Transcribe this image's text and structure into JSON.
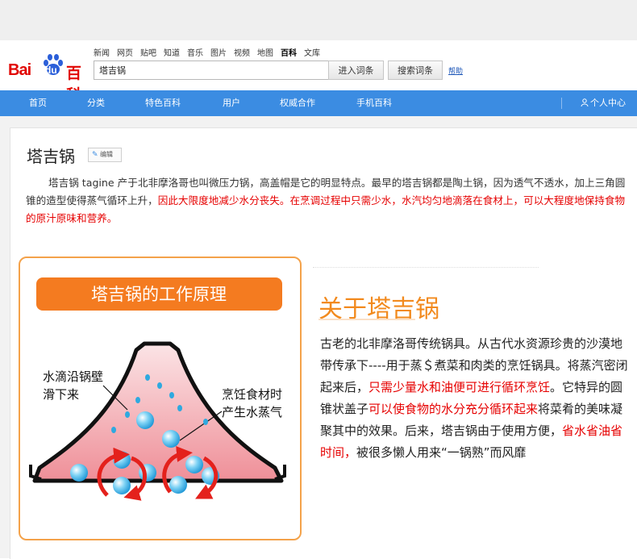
{
  "header": {
    "logo_text_bai": "Bai",
    "logo_text_du": "du",
    "logo_text_baike": "百科",
    "top_links": [
      "新闻",
      "网页",
      "贴吧",
      "知道",
      "音乐",
      "图片",
      "视频",
      "地图",
      "百科",
      "文库"
    ],
    "active_link": "百科",
    "search_value": "塔吉锅",
    "enter_button": "进入词条",
    "search_button": "搜索词条",
    "help_link": "帮助"
  },
  "navbar": {
    "items": [
      "首页",
      "分类",
      "特色百科",
      "用户",
      "权威合作",
      "手机百科"
    ],
    "user_center": "个人中心"
  },
  "entry": {
    "title": "塔吉锅",
    "edit_label": "编辑",
    "intro_plain": "塔吉锅 tagine 产于北非摩洛哥也叫微压力锅，高盖帽是它的明显特点。最早的塔吉锅都是陶土锅，因为透气不透水，加上三角圆锥的造型使得蒸气循环上升，",
    "intro_red": "因此大限度地减少水分丧失。在烹调过程中只需少水，水汽均匀地滴落在食材上，可以大程度地保持食物的原汁原味和营养。"
  },
  "diagram": {
    "title": "塔吉锅的工作原理",
    "label_left_1": "水滴沿锅壁",
    "label_left_2": "滑下来",
    "label_right_1": "烹饪食材时",
    "label_right_2": "产生水蒸气",
    "colors": {
      "border": "#f4a24a",
      "title_bg": "#f47b20",
      "pot_fill": "#f4aab0",
      "arrow": "#e4211c",
      "bubble": "#2fa9df"
    }
  },
  "about": {
    "heading": "关于塔吉锅",
    "p1": "古老的北非摩洛哥传统锅具。从古代水资源珍贵的沙漠地带传承下----用于蒸＄煮菜和肉类的烹饪锅具。将蒸汽密闭起来后，",
    "p1_red": "只需少量水和油便可进行循环烹饪",
    "p2": "。它特异的圆锥状盖子",
    "p2_red": "可以使食物的水分充分循环起来",
    "p3": "将菜肴的美味凝聚其中的效果。后来，塔吉锅由于使用方便，",
    "p3_red": "省水省油省时间，",
    "p4": "被很多懒人用来“一锅熟”而风靡"
  }
}
